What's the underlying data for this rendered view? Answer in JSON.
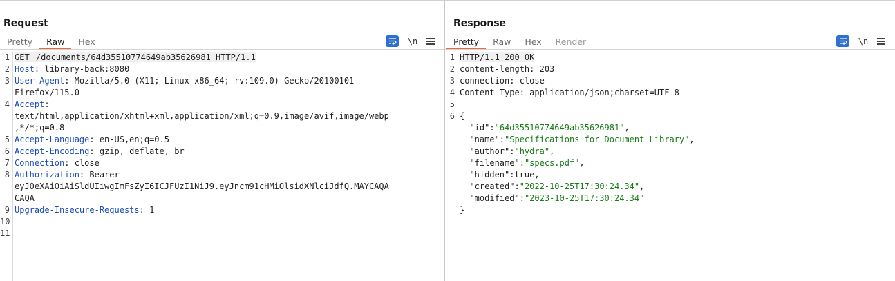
{
  "request": {
    "title": "Request",
    "tabs": [
      "Pretty",
      "Raw",
      "Hex"
    ],
    "active_tab": "Raw",
    "tools": {
      "newline_label": "\\n"
    },
    "line_numbers": [
      "1",
      "2",
      "3",
      "",
      "4",
      "",
      "",
      "5",
      "6",
      "7",
      "8",
      "",
      "",
      "9",
      "10",
      "11"
    ],
    "lines": [
      {
        "key": "",
        "value": "GET /documents/64d35510774649ab35626981 HTTP/1.1"
      },
      {
        "key": "Host",
        "value": ": library-back:8080"
      },
      {
        "key": "User-Agent",
        "value": ": Mozilla/5.0 (X11; Linux x86_64; rv:109.0) Gecko/20100101"
      },
      {
        "key": "",
        "value": "Firefox/115.0"
      },
      {
        "key": "Accept",
        "value": ":"
      },
      {
        "key": "",
        "value": "text/html,application/xhtml+xml,application/xml;q=0.9,image/avif,image/webp"
      },
      {
        "key": "",
        "value": ",*/*;q=0.8"
      },
      {
        "key": "Accept-Language",
        "value": ": en-US,en;q=0.5"
      },
      {
        "key": "Accept-Encoding",
        "value": ": gzip, deflate, br"
      },
      {
        "key": "Connection",
        "value": ": close"
      },
      {
        "key": "Authorization",
        "value": ": Bearer"
      },
      {
        "key": "",
        "value": "eyJ0eXAiOiAiSldUIiwgImFsZyI6ICJFUzI1NiJ9.eyJncm91cHMiOlsidXNlciJdfQ.MAYCAQA"
      },
      {
        "key": "",
        "value": "CAQA"
      },
      {
        "key": "Upgrade-Insecure-Requests",
        "value": ": 1"
      },
      {
        "key": "",
        "value": ""
      },
      {
        "key": "",
        "value": ""
      }
    ]
  },
  "response": {
    "title": "Response",
    "tabs": [
      "Pretty",
      "Raw",
      "Hex",
      "Render"
    ],
    "active_tab": "Pretty",
    "tools": {
      "newline_label": "\\n"
    },
    "line_numbers": [
      "1",
      "2",
      "3",
      "4",
      "5",
      "6",
      "",
      "",
      "",
      "",
      "",
      "",
      "",
      ""
    ],
    "lines": [
      {
        "key": "",
        "value": "HTTP/1.1 200 OK"
      },
      {
        "key": "",
        "value": "content-length: 203"
      },
      {
        "key": "",
        "value": "connection: close"
      },
      {
        "key": "",
        "value": "Content-Type: application/json;charset=UTF-8"
      },
      {
        "key": "",
        "value": ""
      },
      {
        "key": "",
        "value": "{"
      },
      {
        "key": "  \"id\"",
        "value": ":",
        "str": "\"64d35510774649ab35626981\"",
        "tail": ","
      },
      {
        "key": "  \"name\"",
        "value": ":",
        "str": "\"Specifications for Document Library\"",
        "tail": ","
      },
      {
        "key": "  \"author\"",
        "value": ":",
        "str": "\"hydra\"",
        "tail": ","
      },
      {
        "key": "  \"filename\"",
        "value": ":",
        "str": "\"specs.pdf\"",
        "tail": ","
      },
      {
        "key": "  \"hidden\"",
        "value": ":true,",
        "str": "",
        "tail": ""
      },
      {
        "key": "  \"created\"",
        "value": ":",
        "str": "\"2022-10-25T17:30:24.34\"",
        "tail": ","
      },
      {
        "key": "  \"modified\"",
        "value": ":",
        "str": "\"2023-10-25T17:30:24.34\"",
        "tail": ""
      },
      {
        "key": "",
        "value": "}"
      }
    ]
  },
  "layout_switch": [
    "side-by-side",
    "stacked",
    "tabbed"
  ],
  "colors": {
    "accent": "#e8693a",
    "button": "#2f6fcf",
    "header_key": "#1e4db7",
    "string": "#1b7a1b"
  }
}
